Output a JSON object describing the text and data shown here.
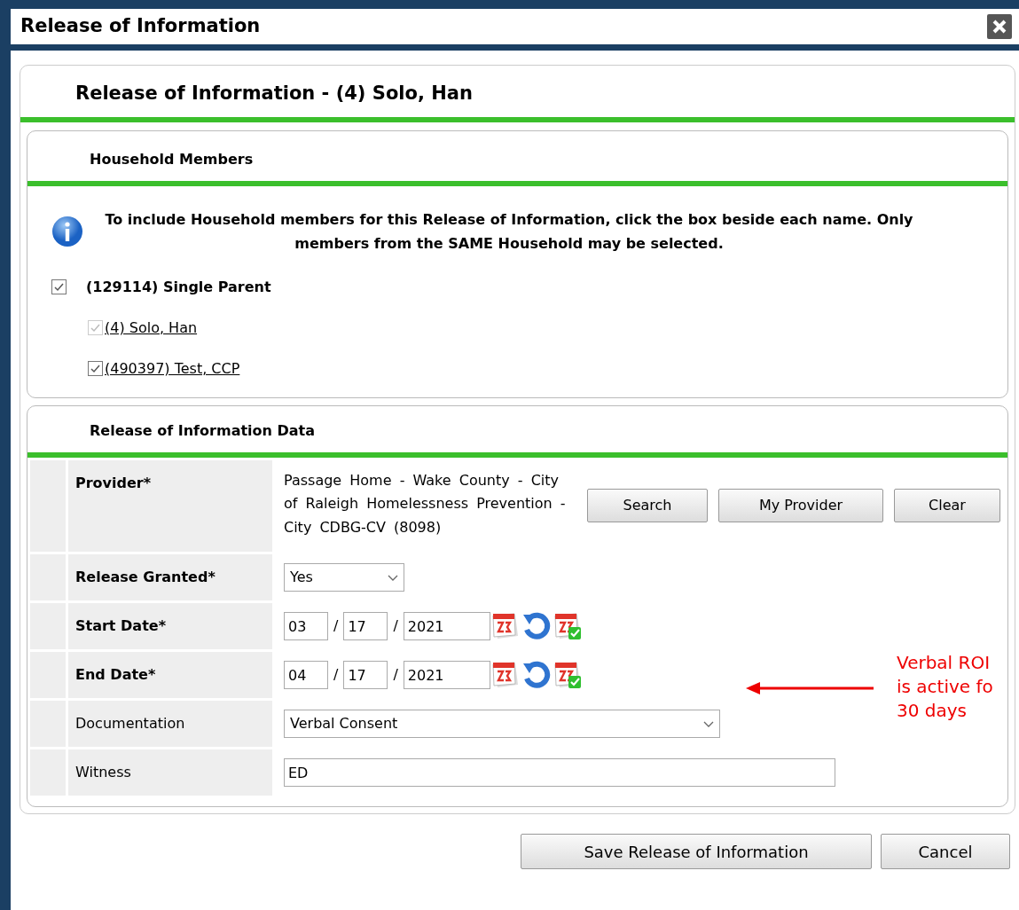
{
  "dialog": {
    "title": "Release of Information"
  },
  "panel": {
    "title": "Release of Information - (4) Solo, Han"
  },
  "household": {
    "title": "Household Members",
    "info": "To include Household members for this Release of Information, click the box beside each name. Only members from the SAME Household may be selected.",
    "group": {
      "label": "(129114) Single Parent",
      "checked": true,
      "children": [
        {
          "label": "(4) Solo, Han",
          "checked": true,
          "disabled": true
        },
        {
          "label": "(490397) Test, CCP",
          "checked": true,
          "disabled": false
        }
      ]
    }
  },
  "roi_data": {
    "title": "Release of Information Data",
    "fields": [
      {
        "kind": "provider",
        "label": "Provider",
        "required": true,
        "mark": "*",
        "value": "Passage Home - Wake County - City of Raleigh Homelessness Prevention - City CDBG-CV (8098)",
        "buttons": [
          "Search",
          "My Provider",
          "Clear"
        ]
      },
      {
        "kind": "select",
        "label": "Release Granted",
        "required": true,
        "mark": "*",
        "value": "Yes"
      },
      {
        "kind": "date",
        "label": "Start Date",
        "required": true,
        "mark": "*",
        "month": "03",
        "day": "17",
        "year": "2021",
        "separators": [
          "/",
          "/"
        ]
      },
      {
        "kind": "date",
        "label": "End Date",
        "required": true,
        "mark": "*",
        "month": "04",
        "day": "17",
        "year": "2021",
        "separators": [
          "/",
          "/"
        ]
      },
      {
        "kind": "long_select",
        "label": "Documentation",
        "required": false,
        "value": "Verbal Consent"
      },
      {
        "kind": "text",
        "label": "Witness",
        "required": false,
        "value": "ED"
      }
    ]
  },
  "annotation": {
    "lines": [
      "Verbal ROI",
      "is active fo",
      "30 days"
    ]
  },
  "buttons": [
    "Save Release of Information",
    "Cancel"
  ]
}
